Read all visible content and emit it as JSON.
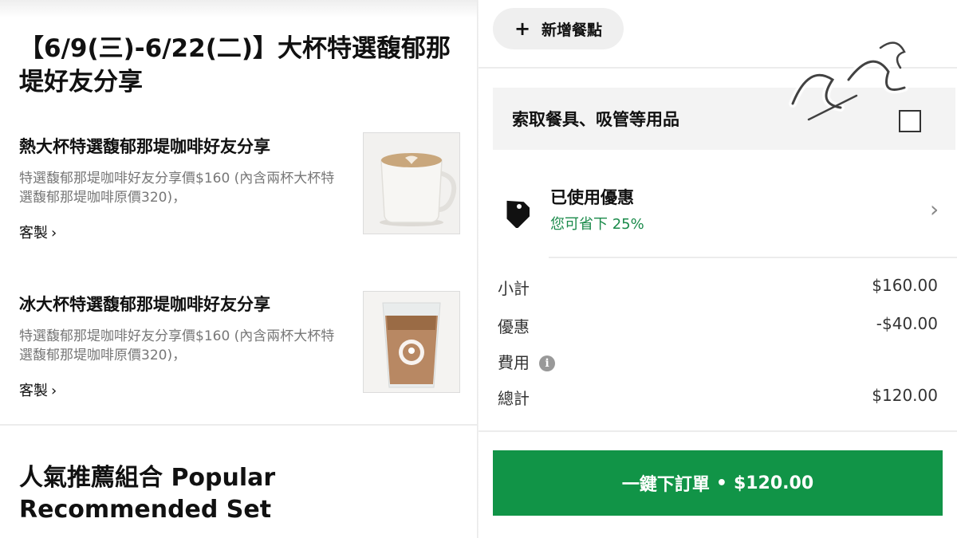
{
  "left": {
    "promo_title": "【6/9(三)-6/22(二)】大杯特選馥郁那堤好友分享",
    "items": [
      {
        "name": "熱大杯特選馥郁那堤咖啡好友分享",
        "description": "特選馥郁那堤咖啡好友分享價$160 (內含兩杯大杯特選馥郁那堤咖啡原價320)，",
        "customize_label": "客製",
        "image": "hot-latte-mug"
      },
      {
        "name": "冰大杯特選馥郁那堤咖啡好友分享",
        "description": "特選馥郁那堤咖啡好友分享價$160 (內含兩杯大杯特選馥郁那堤咖啡原價320)，",
        "customize_label": "客製",
        "image": "iced-latte-cup"
      }
    ],
    "section_title": "人氣推薦組合 Popular Recommended Set"
  },
  "right": {
    "add_item_label": "新增餐點",
    "utensils_label": "索取餐具、吸管等用品",
    "utensils_checked": false,
    "promotion": {
      "title": "已使用優惠",
      "subtitle": "您可省下 25%"
    },
    "summary": {
      "subtotal_label": "小計",
      "subtotal_value": "$160.00",
      "discount_label": "優惠",
      "discount_value": "-$40.00",
      "fee_label": "費用",
      "total_label": "總計",
      "total_value": "$120.00"
    },
    "checkout": {
      "label": "一鍵下訂單",
      "separator": "•",
      "amount": "$120.00"
    }
  },
  "colors": {
    "accent_green": "#119447",
    "savings_green": "#1a8a4a"
  }
}
